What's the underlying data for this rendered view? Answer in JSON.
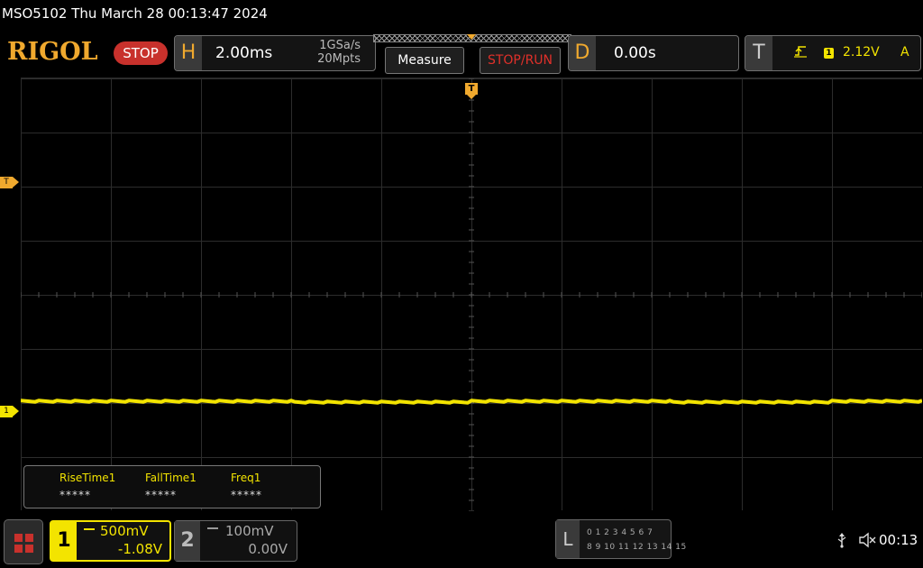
{
  "title_bar": {
    "text": "MSO5102  Thu March 28 00:13:47 2024"
  },
  "header": {
    "logo": "RIGOL",
    "run_state": "STOP",
    "horizontal": {
      "letter": "H",
      "timebase": "2.00ms",
      "sample_rate": "1GSa/s",
      "memory_depth": "20Mpts"
    },
    "buttons": {
      "measure": "Measure",
      "stop_run": "STOP/RUN"
    },
    "delay": {
      "letter": "D",
      "value": "0.00s"
    },
    "trigger": {
      "letter": "T",
      "channel": "1",
      "level": "2.12V",
      "mode": "A"
    }
  },
  "screen": {
    "trigger_marker": "T",
    "trigger_level_marker": "T",
    "channel_marker": "1"
  },
  "measurements": [
    {
      "label": "RiseTime1",
      "value": "*****"
    },
    {
      "label": "FallTime1",
      "value": "*****"
    },
    {
      "label": "Freq1",
      "value": "*****"
    }
  ],
  "footer": {
    "ch1": {
      "num": "1",
      "scale": "500mV",
      "offset": "-1.08V"
    },
    "ch2": {
      "num": "2",
      "scale": "100mV",
      "offset": "0.00V"
    },
    "logic": {
      "label": "L",
      "row1": "0 1 2 3   4 5 6 7",
      "row2": "8 9 10 11  12 13 14 15"
    },
    "time": "00:13"
  },
  "colors": {
    "ch1": "#f3e400",
    "accent": "#f0a92e",
    "stop": "#c8312c"
  }
}
